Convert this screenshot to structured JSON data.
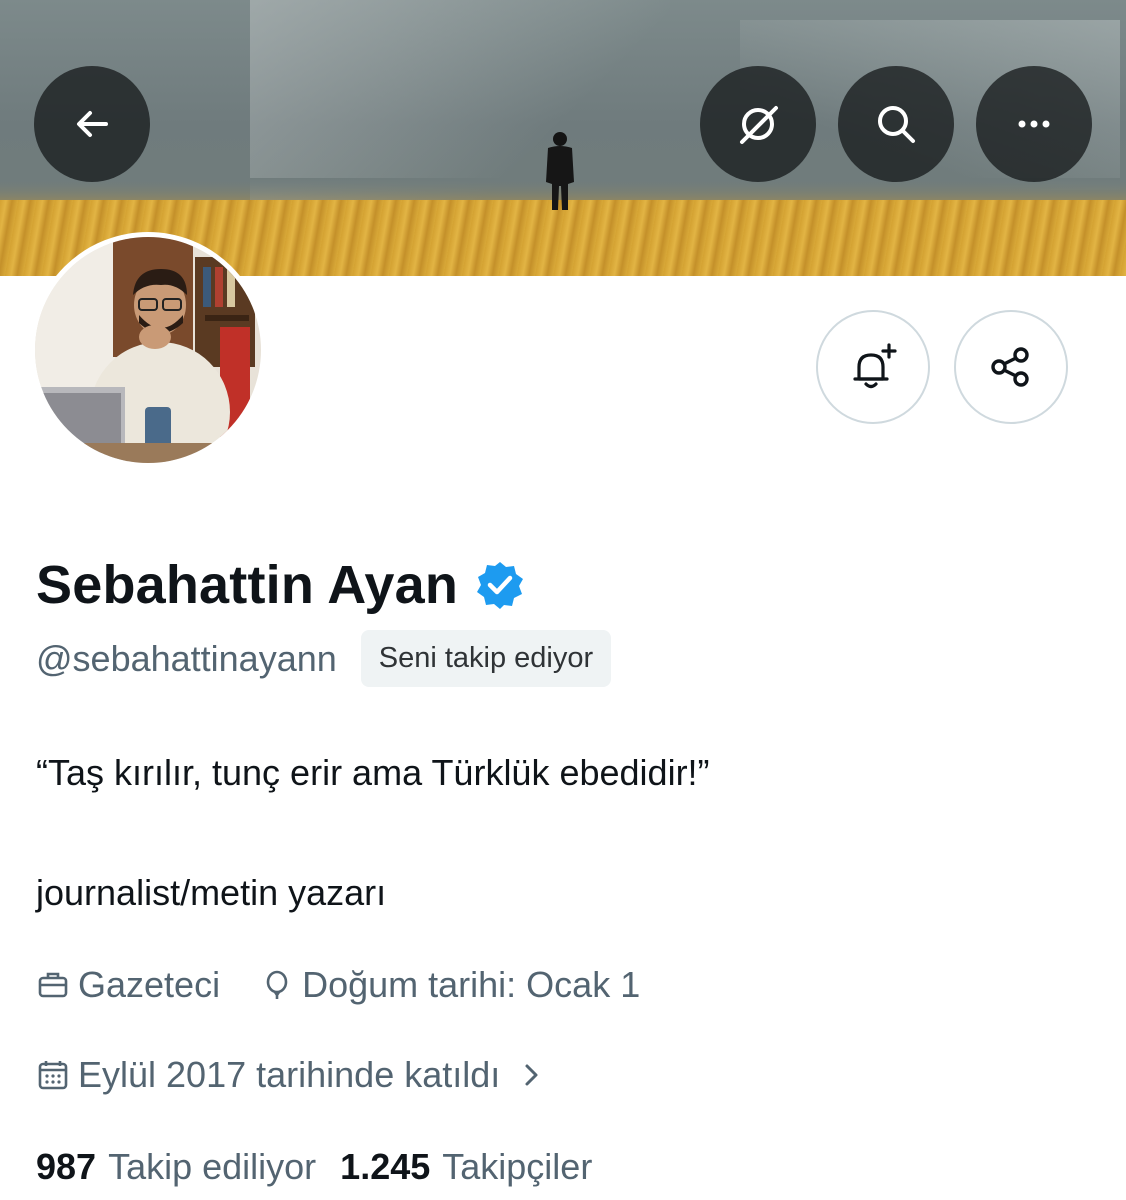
{
  "header": {
    "back_icon": "arrow-left-icon",
    "actions": [
      {
        "name": "grok-icon"
      },
      {
        "name": "search-icon"
      },
      {
        "name": "more-icon"
      }
    ]
  },
  "profile": {
    "name": "Sebahattin Ayan",
    "verified": true,
    "handle": "@sebahattinayann",
    "follows_you_badge": "Seni takip ediyor",
    "bio_quote": "“Taş kırılır, tunç erir ama Türklük ebedidir!”",
    "bio_line2": "journalist/metin yazarı",
    "profession": "Gazeteci",
    "birthday": "Doğum tarihi: Ocak 1",
    "joined": "Eylül 2017 tarihinde katıldı",
    "following_count": "987",
    "following_label": "Takip ediliyor",
    "followers_count": "1.245",
    "followers_label": "Takipçiler"
  },
  "buttons": {
    "notify_icon": "bell-plus-icon",
    "share_icon": "share-icon"
  },
  "colors": {
    "text_primary": "#0f1419",
    "text_secondary": "#536471",
    "verified_blue": "#1d9bf0",
    "badge_bg": "#eff3f4"
  }
}
